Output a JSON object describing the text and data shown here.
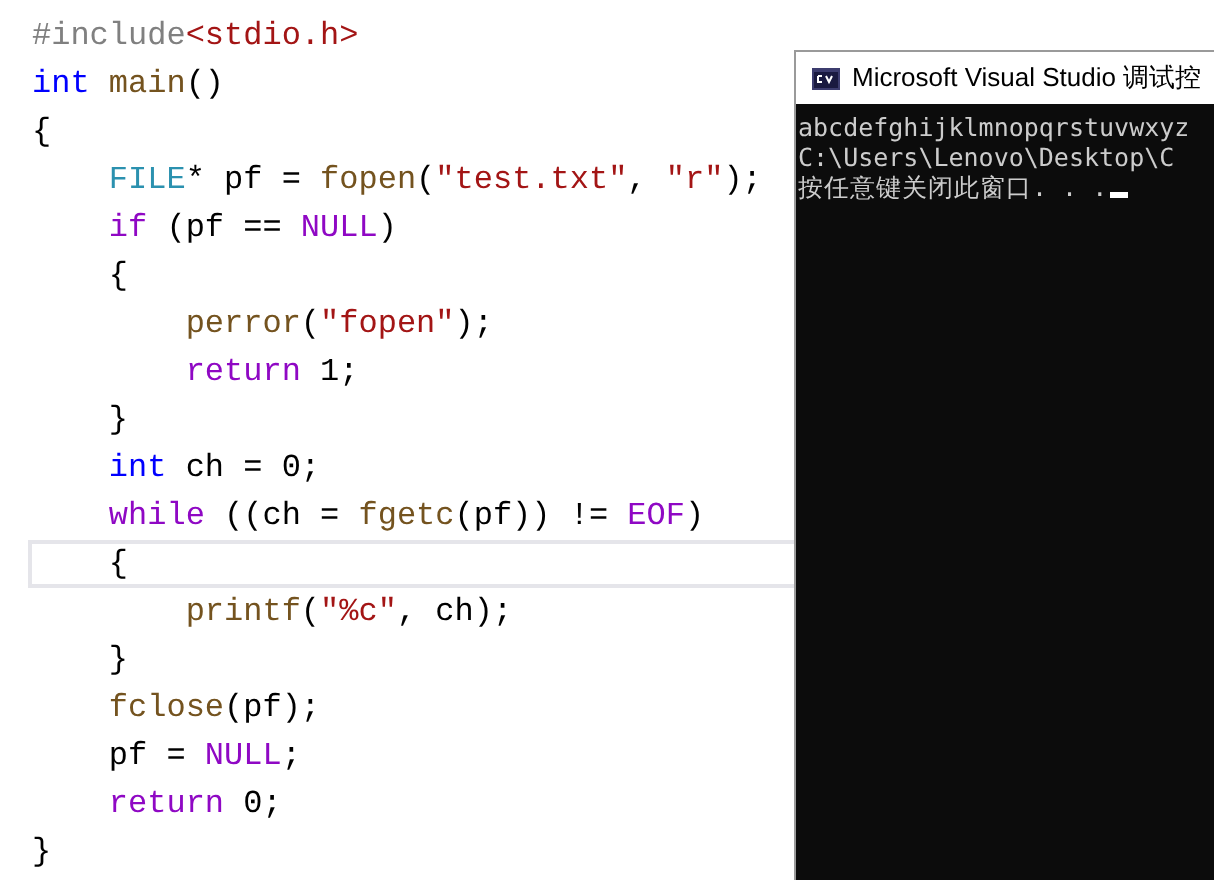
{
  "editor": {
    "lines": [
      {
        "current": false,
        "tokens": [
          {
            "text": "#include",
            "kind": "preprocessor"
          },
          {
            "text": "<stdio.h>",
            "kind": "include_path"
          }
        ]
      },
      {
        "current": false,
        "tokens": [
          {
            "text": "int",
            "kind": "keyword"
          },
          {
            "text": " main",
            "kind": "func"
          },
          {
            "text": "()",
            "kind": "plain"
          }
        ]
      },
      {
        "current": false,
        "tokens": [
          {
            "text": "{",
            "kind": "plain"
          }
        ]
      },
      {
        "current": false,
        "tokens": [
          {
            "text": "    FILE",
            "kind": "type"
          },
          {
            "text": "* pf = ",
            "kind": "plain"
          },
          {
            "text": "fopen",
            "kind": "func"
          },
          {
            "text": "(",
            "kind": "plain"
          },
          {
            "text": "\"test.txt\"",
            "kind": "string"
          },
          {
            "text": ", ",
            "kind": "plain"
          },
          {
            "text": "\"r\"",
            "kind": "string"
          },
          {
            "text": ");",
            "kind": "plain"
          }
        ]
      },
      {
        "current": false,
        "tokens": [
          {
            "text": "    if",
            "kind": "control"
          },
          {
            "text": " (pf == ",
            "kind": "plain"
          },
          {
            "text": "NULL",
            "kind": "macro"
          },
          {
            "text": ")",
            "kind": "plain"
          }
        ]
      },
      {
        "current": false,
        "tokens": [
          {
            "text": "    {",
            "kind": "plain"
          }
        ]
      },
      {
        "current": false,
        "tokens": [
          {
            "text": "        perror",
            "kind": "func"
          },
          {
            "text": "(",
            "kind": "plain"
          },
          {
            "text": "\"fopen\"",
            "kind": "string"
          },
          {
            "text": ");",
            "kind": "plain"
          }
        ]
      },
      {
        "current": false,
        "tokens": [
          {
            "text": "        return",
            "kind": "control"
          },
          {
            "text": " 1;",
            "kind": "plain"
          }
        ]
      },
      {
        "current": false,
        "tokens": [
          {
            "text": "    }",
            "kind": "plain"
          }
        ]
      },
      {
        "current": false,
        "tokens": [
          {
            "text": "    int",
            "kind": "keyword"
          },
          {
            "text": " ch = 0;",
            "kind": "plain"
          }
        ]
      },
      {
        "current": false,
        "tokens": [
          {
            "text": "    while",
            "kind": "control"
          },
          {
            "text": " ((ch = ",
            "kind": "plain"
          },
          {
            "text": "fgetc",
            "kind": "func"
          },
          {
            "text": "(pf)) != ",
            "kind": "plain"
          },
          {
            "text": "EOF",
            "kind": "macro"
          },
          {
            "text": ")",
            "kind": "plain"
          }
        ]
      },
      {
        "current": true,
        "tokens": [
          {
            "text": "    {",
            "kind": "plain"
          }
        ]
      },
      {
        "current": false,
        "tokens": [
          {
            "text": "        printf",
            "kind": "func"
          },
          {
            "text": "(",
            "kind": "plain"
          },
          {
            "text": "\"%c\"",
            "kind": "string"
          },
          {
            "text": ", ch);",
            "kind": "plain"
          }
        ]
      },
      {
        "current": false,
        "tokens": [
          {
            "text": "    }",
            "kind": "plain"
          }
        ]
      },
      {
        "current": false,
        "tokens": [
          {
            "text": "    fclose",
            "kind": "func"
          },
          {
            "text": "(pf);",
            "kind": "plain"
          }
        ]
      },
      {
        "current": false,
        "tokens": [
          {
            "text": "    pf = ",
            "kind": "plain"
          },
          {
            "text": "NULL",
            "kind": "macro"
          },
          {
            "text": ";",
            "kind": "plain"
          }
        ]
      },
      {
        "current": false,
        "tokens": [
          {
            "text": "    return",
            "kind": "control"
          },
          {
            "text": " 0;",
            "kind": "plain"
          }
        ]
      },
      {
        "current": false,
        "tokens": [
          {
            "text": "}",
            "kind": "plain"
          }
        ]
      }
    ]
  },
  "console": {
    "title": "Microsoft Visual Studio 调试控",
    "lines": [
      "abcdefghijklmnopqrstuvwxyz",
      "C:\\Users\\Lenovo\\Desktop\\C",
      "按任意键关闭此窗口. . ."
    ],
    "cursor": true
  }
}
